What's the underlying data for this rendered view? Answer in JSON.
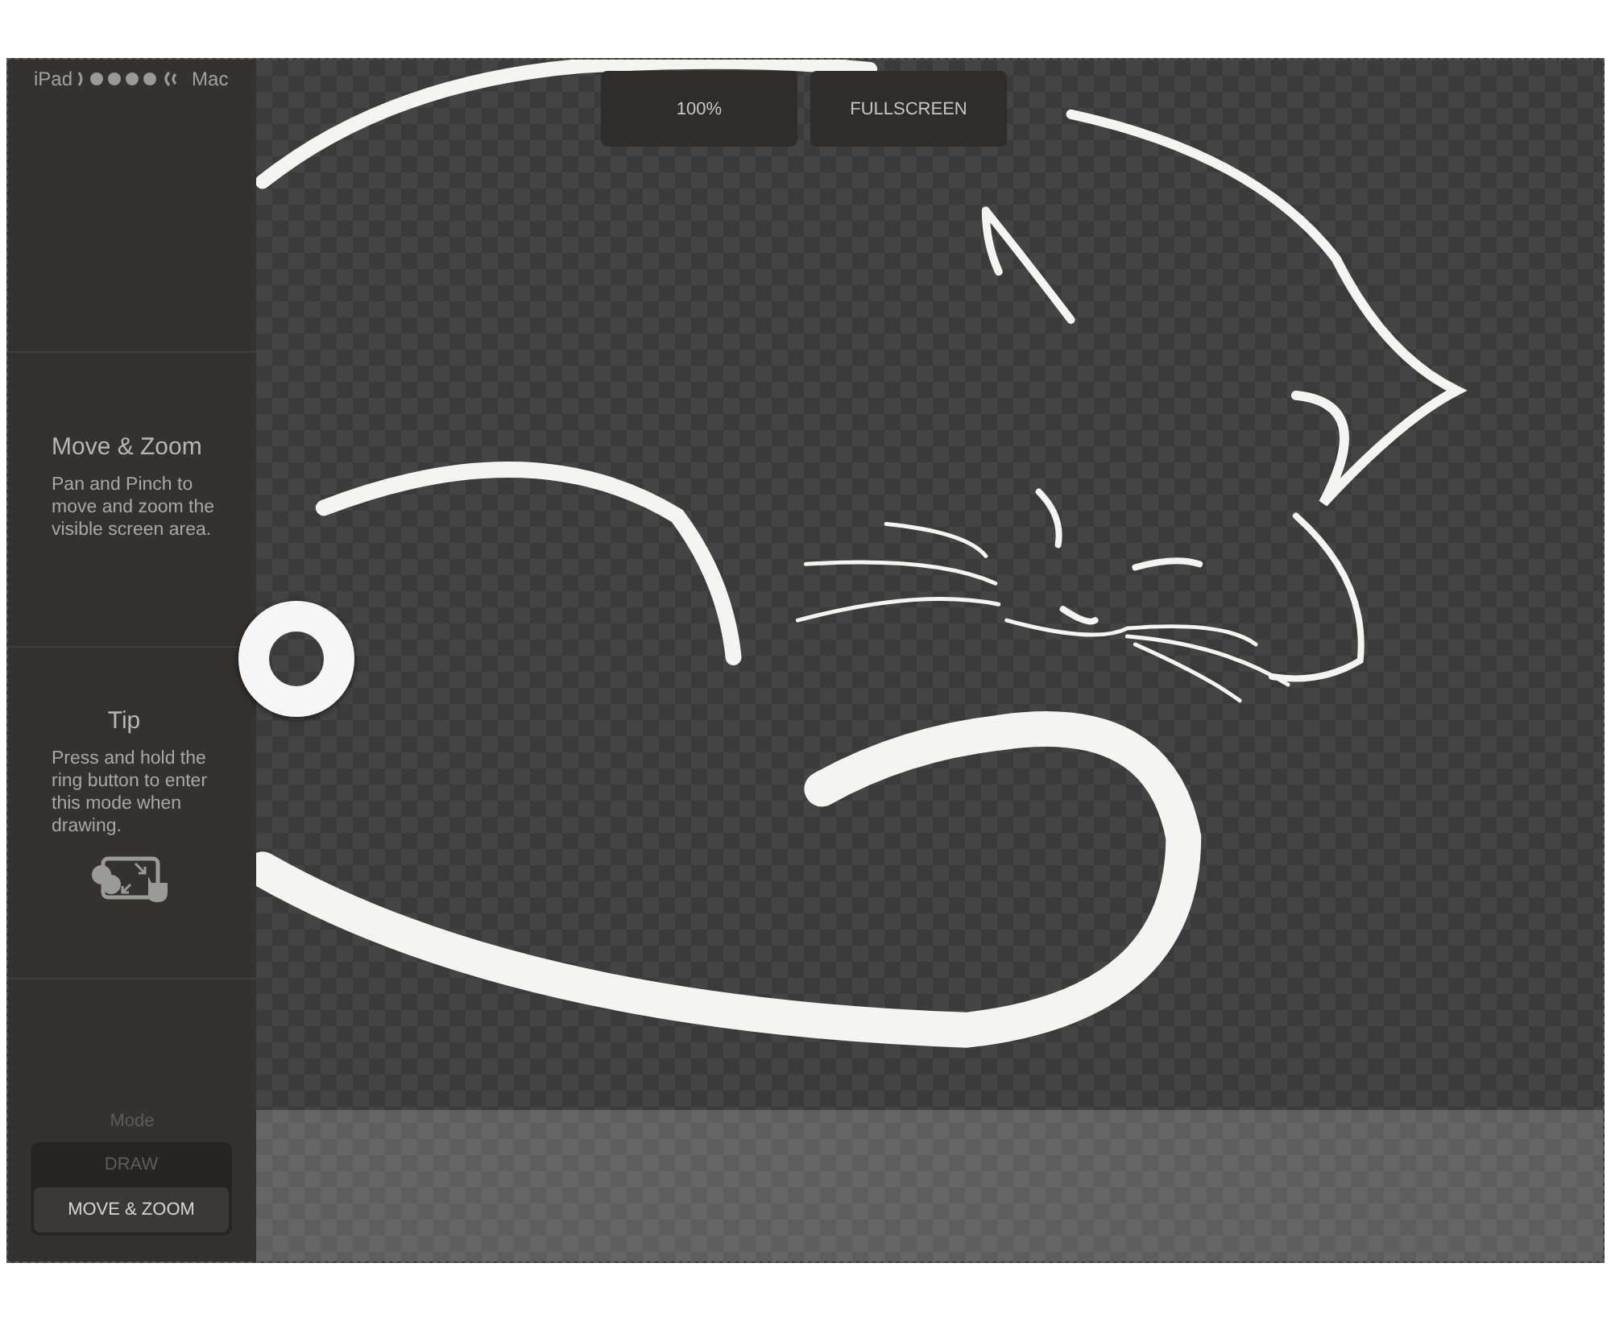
{
  "status": {
    "left": "iPad",
    "right": "Mac"
  },
  "info": {
    "title": "Move & Zoom",
    "text": "Pan and Pinch to move and zoom the visible screen area."
  },
  "tip": {
    "title": "Tip",
    "text": "Press and hold the ring button to enter this mode when drawing."
  },
  "mode": {
    "label": "Mode",
    "options": [
      {
        "label": "DRAW",
        "selected": false
      },
      {
        "label": "MOVE & ZOOM",
        "selected": true
      }
    ]
  },
  "toolbar": {
    "buttons": [
      "100%",
      "FULLSCREEN"
    ]
  }
}
